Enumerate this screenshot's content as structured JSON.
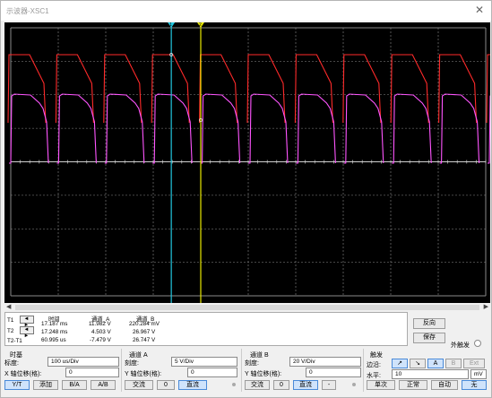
{
  "window": {
    "title": "示波器-XSC1",
    "close_label": "✕"
  },
  "screen": {
    "grid_cols": 10,
    "grid_rows": 8,
    "cursor1_label": "1",
    "cursor2_label": "2",
    "cursor1_fraction": 0.338,
    "cursor2_fraction": 0.4,
    "colors": {
      "background": "#000000",
      "channel_a": "#ff2a2a",
      "channel_b": "#ff55ff",
      "cursor1": "#22c8e0",
      "cursor2": "#e8e800",
      "grid": "#8a8a8a"
    }
  },
  "scrollbar": {
    "left_arrow": "◀",
    "right_arrow": "▶"
  },
  "readout": {
    "headers": {
      "time": "时间",
      "ch_a": "通道_A",
      "ch_b": "通道_B"
    },
    "rows": [
      {
        "label": "T1",
        "arrows": "◄ ►",
        "time": "17.187 ms",
        "ch_a": "11.982 V",
        "ch_b": "220.284 mV"
      },
      {
        "label": "T2",
        "arrows": "◄ ►",
        "time": "17.248 ms",
        "ch_a": "4.503 V",
        "ch_b": "26.967 V"
      },
      {
        "label": "T2-T1",
        "arrows": "",
        "time": "60.995 us",
        "ch_a": "-7.479 V",
        "ch_b": "26.747 V"
      }
    ]
  },
  "side_buttons": {
    "reverse": "反向",
    "save": "保存",
    "ext_trigger": "外触发"
  },
  "timebase": {
    "title": "时基",
    "scale_label": "标度:",
    "scale_value": "100 us/Div",
    "xpos_label": "X 轴位移(格):",
    "xpos_value": "0",
    "buttons": [
      "Y/T",
      "添加",
      "B/A",
      "A/B"
    ]
  },
  "channel_a": {
    "title": "通道 A",
    "scale_label": "刻度:",
    "scale_value": "5  V/Div",
    "ypos_label": "Y 轴位移(格):",
    "ypos_value": "0",
    "buttons": [
      "交流",
      "0",
      "直流"
    ]
  },
  "channel_b": {
    "title": "通道 B",
    "scale_label": "刻度:",
    "scale_value": "20  V/Div",
    "ypos_label": "Y 轴位移(格):",
    "ypos_value": "0",
    "buttons": [
      "交流",
      "0",
      "直流",
      "-"
    ]
  },
  "trigger": {
    "title": "触发",
    "edge_label": "边沿:",
    "edge_buttons": [
      "↗",
      "↘",
      "A",
      "B",
      "Ext"
    ],
    "level_label": "水平:",
    "level_value": "10",
    "level_unit": "mV",
    "mode_buttons": [
      "单次",
      "正常",
      "自动",
      "无"
    ]
  }
}
